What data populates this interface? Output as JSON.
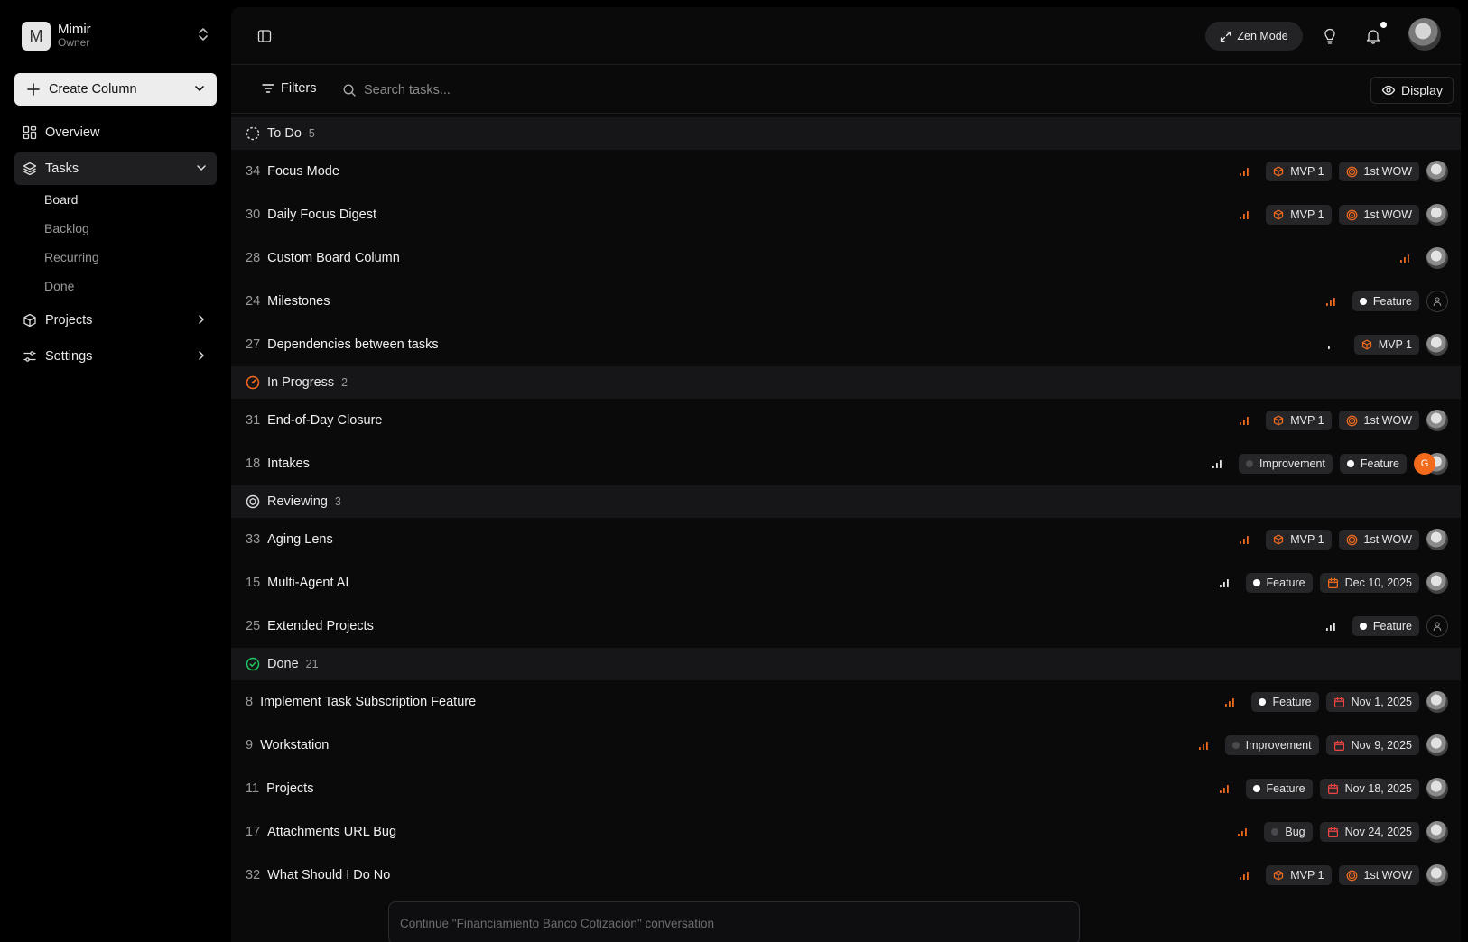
{
  "workspace": {
    "initial": "M",
    "name": "Mimir",
    "role": "Owner"
  },
  "sidebar": {
    "create_label": "Create Column",
    "items": [
      {
        "label": "Overview"
      },
      {
        "label": "Tasks",
        "sub": [
          "Board",
          "Backlog",
          "Recurring",
          "Done"
        ]
      },
      {
        "label": "Projects"
      },
      {
        "label": "Settings"
      }
    ]
  },
  "header": {
    "zen_label": "Zen Mode"
  },
  "toolbar": {
    "filters_label": "Filters",
    "search_placeholder": "Search tasks...",
    "display_label": "Display"
  },
  "colors": {
    "accent_orange": "#f26b1d",
    "done_green": "#22c55e",
    "date_red": "#ef4444",
    "feature_dot": "#ffffff"
  },
  "groups": [
    {
      "name": "To Do",
      "count": "5",
      "icon": "dashed-circle-icon",
      "tasks": [
        {
          "id": "34",
          "title": "Focus Mode",
          "priority": 3,
          "tags": [
            {
              "type": "project",
              "label": "MVP 1"
            },
            {
              "type": "milestone",
              "label": "1st WOW"
            }
          ],
          "assignee": "avatar"
        },
        {
          "id": "30",
          "title": "Daily Focus Digest",
          "priority": 3,
          "tags": [
            {
              "type": "project",
              "label": "MVP 1"
            },
            {
              "type": "milestone",
              "label": "1st WOW"
            }
          ],
          "assignee": "avatar"
        },
        {
          "id": "28",
          "title": "Custom Board Column",
          "priority": 3,
          "tags": [],
          "assignee": "avatar"
        },
        {
          "id": "24",
          "title": "Milestones",
          "priority": 3,
          "tags": [
            {
              "type": "label-white",
              "label": "Feature"
            }
          ],
          "assignee": "none"
        },
        {
          "id": "27",
          "title": "Dependencies between tasks",
          "priority": 1,
          "tags": [
            {
              "type": "project",
              "label": "MVP 1"
            }
          ],
          "assignee": "avatar"
        }
      ]
    },
    {
      "name": "In Progress",
      "count": "2",
      "icon": "in-progress-icon",
      "tasks": [
        {
          "id": "31",
          "title": "End-of-Day Closure",
          "priority": 3,
          "tags": [
            {
              "type": "project",
              "label": "MVP 1"
            },
            {
              "type": "milestone",
              "label": "1st WOW"
            }
          ],
          "assignee": "avatar"
        },
        {
          "id": "18",
          "title": "Intakes",
          "priority": 2,
          "tags": [
            {
              "type": "label-gray",
              "label": "Improvement"
            },
            {
              "type": "label-white",
              "label": "Feature"
            }
          ],
          "assignee": "stack",
          "assignee_initial": "G"
        }
      ]
    },
    {
      "name": "Reviewing",
      "count": "3",
      "icon": "reviewing-icon",
      "tasks": [
        {
          "id": "33",
          "title": "Aging Lens",
          "priority": 3,
          "tags": [
            {
              "type": "project",
              "label": "MVP 1"
            },
            {
              "type": "milestone",
              "label": "1st WOW"
            }
          ],
          "assignee": "avatar"
        },
        {
          "id": "15",
          "title": "Multi-Agent AI",
          "priority": 2,
          "tags": [
            {
              "type": "label-white",
              "label": "Feature"
            },
            {
              "type": "date-orange",
              "label": "Dec 10, 2025"
            }
          ],
          "assignee": "avatar"
        },
        {
          "id": "25",
          "title": "Extended Projects",
          "priority": 2,
          "tags": [
            {
              "type": "label-white",
              "label": "Feature"
            }
          ],
          "assignee": "none"
        }
      ]
    },
    {
      "name": "Done",
      "count": "21",
      "icon": "done-check-icon",
      "tasks": [
        {
          "id": "8",
          "title": "Implement Task Subscription Feature",
          "priority": 3,
          "tags": [
            {
              "type": "label-white",
              "label": "Feature"
            },
            {
              "type": "date-red",
              "label": "Nov 1, 2025"
            }
          ],
          "assignee": "avatar"
        },
        {
          "id": "9",
          "title": "Workstation",
          "priority": 3,
          "tags": [
            {
              "type": "label-gray",
              "label": "Improvement"
            },
            {
              "type": "date-red",
              "label": "Nov 9, 2025"
            }
          ],
          "assignee": "avatar"
        },
        {
          "id": "11",
          "title": "Projects",
          "priority": 3,
          "tags": [
            {
              "type": "label-white",
              "label": "Feature"
            },
            {
              "type": "date-red",
              "label": "Nov 18, 2025"
            }
          ],
          "assignee": "avatar"
        },
        {
          "id": "17",
          "title": "Attachments URL Bug",
          "priority": 3,
          "tags": [
            {
              "type": "label-gray",
              "label": "Bug"
            },
            {
              "type": "date-red",
              "label": "Nov 24, 2025"
            }
          ],
          "assignee": "avatar"
        },
        {
          "id": "32",
          "title": "What Should I Do No",
          "priority": 3,
          "tags": [
            {
              "type": "project",
              "label": "MVP 1"
            },
            {
              "type": "milestone",
              "label": "1st WOW"
            }
          ],
          "assignee": "avatar"
        }
      ]
    }
  ],
  "continue_prompt": "Continue \"Financiamiento Banco Cotización\" conversation"
}
